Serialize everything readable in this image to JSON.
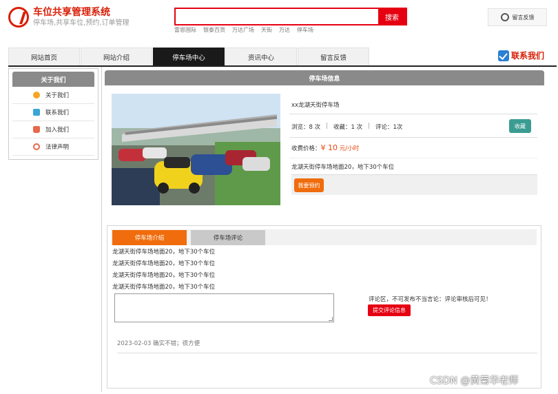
{
  "brand": {
    "title": "车位共享管理系统",
    "subtitle": "停车场,共享车位,预约,订单管理"
  },
  "search": {
    "placeholder": "",
    "button_label": "搜索",
    "hot_words": [
      "雷恩国际",
      "银泰百货",
      "万达广场",
      "天街",
      "万达",
      "停车场"
    ]
  },
  "header": {
    "feedback_label": "留言反馈",
    "contact_label": "联系我们"
  },
  "nav": {
    "items": [
      "网站首页",
      "网站介绍",
      "停车场中心",
      "资讯中心",
      "留言反馈"
    ],
    "active_index": 2
  },
  "sidebar": {
    "title": "关于我们",
    "items": [
      {
        "label": "关于我们",
        "icon": "info-icon"
      },
      {
        "label": "联系我们",
        "icon": "contact-icon"
      },
      {
        "label": "加入我们",
        "icon": "lock-icon"
      },
      {
        "label": "法律声明",
        "icon": "power-icon"
      }
    ]
  },
  "parking": {
    "section_title": "停车场信息",
    "name": "xx龙湖天街停车场",
    "views": "浏览：8 次",
    "favorites": "收藏：1 次",
    "comments": "评论：1次",
    "favorite_button": "收藏",
    "price_label": "收费价格：",
    "price_value": "¥ 10",
    "price_unit": "元/小时",
    "description": "龙湖天街停车场地面20，地下30个车位",
    "reserve_button": "我要预约",
    "photo_alt": "parking-lot-photo"
  },
  "tabs": {
    "items": [
      "停车场介绍",
      "停车场评论"
    ],
    "active_index": 0
  },
  "intro": {
    "lines": [
      "龙湖天街停车场地面20，地下30个车位",
      "龙湖天街停车场地面20，地下30个车位",
      "龙湖天街停车场地面20，地下30个车位",
      "龙湖天街停车场地面20，地下30个车位"
    ]
  },
  "comment": {
    "input_value": "",
    "notice": "评论区，不可发布不当言论：评论审核后可见！",
    "submit_button": "提交评论信息",
    "reviews": [
      {
        "text": "2023-02-03 确实不错；很方便"
      }
    ]
  },
  "watermark": "CSDN @黄菊华老师",
  "colors": {
    "brand_red": "#d81e06",
    "accent_orange": "#f06c0c",
    "teal": "#3a9c92",
    "nav_active": "#1a1a1a"
  }
}
